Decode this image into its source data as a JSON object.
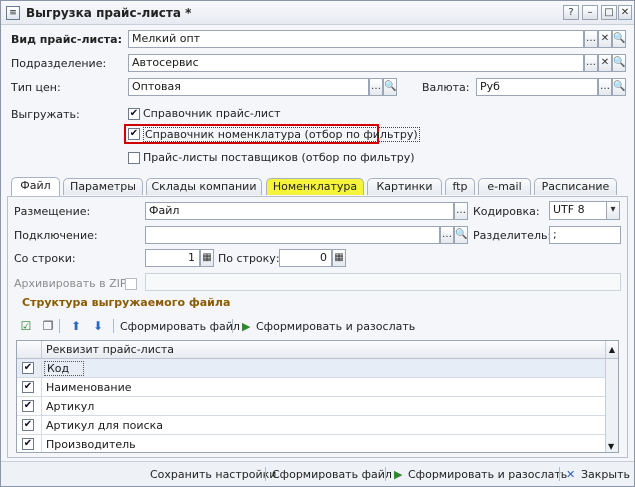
{
  "window": {
    "title": "Выгрузка прайс-листа *"
  },
  "header": {
    "kind_label": "Вид прайс-листа:",
    "kind_value": "Мелкий опт",
    "division_label": "Подразделение:",
    "division_value": "Автосервис",
    "price_type_label": "Тип цен:",
    "price_type_value": "Оптовая",
    "currency_label": "Валюта:",
    "currency_value": "Руб",
    "export_label": "Выгружать:",
    "export_options": [
      {
        "label": "Справочник прайс-лист",
        "checked": true
      },
      {
        "label": "Справочник номенклатура (отбор по фильтру)",
        "checked": true
      },
      {
        "label": "Прайс-листы поставщиков (отбор по фильтру)",
        "checked": false
      }
    ]
  },
  "tabs": [
    "Файл",
    "Параметры",
    "Склады компании",
    "Номенклатура",
    "Картинки",
    "ftp",
    "e-mail",
    "Расписание"
  ],
  "file_tab": {
    "placement_label": "Размещение:",
    "placement_value": "Файл",
    "encoding_label": "Кодировка:",
    "encoding_value": "UTF 8",
    "connection_label": "Подключение:",
    "connection_value": "",
    "separator_label": "Разделитель:",
    "separator_value": ";",
    "from_row_label": "Со строки:",
    "from_row_value": "1",
    "to_row_label": "По строку:",
    "to_row_value": "0",
    "zip_label": "Архивировать в ZIP:",
    "structure_title": "Структура выгружаемого файла",
    "toolbar": {
      "generate": "Сформировать файл",
      "generate_send": "Сформировать и разослать"
    },
    "grid_header": "Реквизит прайс-листа",
    "rows": [
      {
        "label": "Код",
        "checked": true
      },
      {
        "label": "Наименование",
        "checked": true
      },
      {
        "label": "Артикул",
        "checked": true
      },
      {
        "label": "Артикул для поиска",
        "checked": true
      },
      {
        "label": "Производитель",
        "checked": true
      }
    ]
  },
  "footer": {
    "save": "Сохранить настройки",
    "generate": "Сформировать файл",
    "generate_send": "Сформировать и разослать",
    "close": "Закрыть"
  },
  "colors": {
    "highlight_tab": "#f5f33a",
    "red_frame": "#d00000",
    "section_title": "#8a5b00"
  }
}
